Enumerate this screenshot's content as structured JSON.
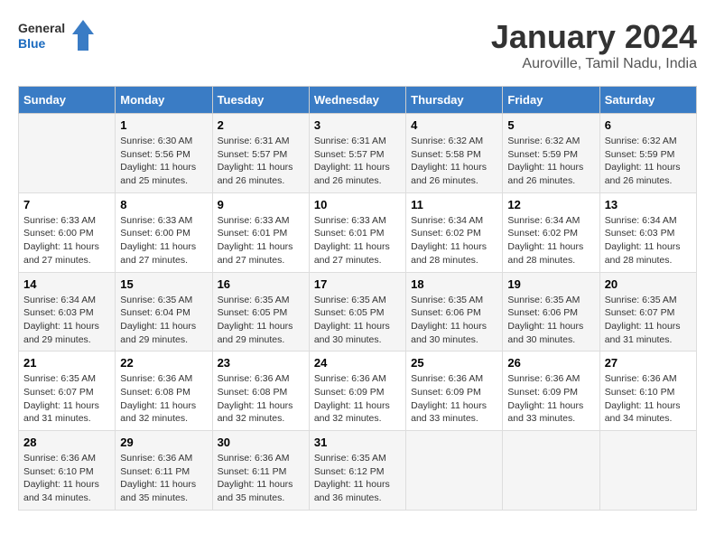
{
  "header": {
    "logo_general": "General",
    "logo_blue": "Blue",
    "main_title": "January 2024",
    "subtitle": "Auroville, Tamil Nadu, India"
  },
  "columns": [
    "Sunday",
    "Monday",
    "Tuesday",
    "Wednesday",
    "Thursday",
    "Friday",
    "Saturday"
  ],
  "weeks": [
    [
      {
        "day": "",
        "info": ""
      },
      {
        "day": "1",
        "info": "Sunrise: 6:30 AM\nSunset: 5:56 PM\nDaylight: 11 hours\nand 25 minutes."
      },
      {
        "day": "2",
        "info": "Sunrise: 6:31 AM\nSunset: 5:57 PM\nDaylight: 11 hours\nand 26 minutes."
      },
      {
        "day": "3",
        "info": "Sunrise: 6:31 AM\nSunset: 5:57 PM\nDaylight: 11 hours\nand 26 minutes."
      },
      {
        "day": "4",
        "info": "Sunrise: 6:32 AM\nSunset: 5:58 PM\nDaylight: 11 hours\nand 26 minutes."
      },
      {
        "day": "5",
        "info": "Sunrise: 6:32 AM\nSunset: 5:59 PM\nDaylight: 11 hours\nand 26 minutes."
      },
      {
        "day": "6",
        "info": "Sunrise: 6:32 AM\nSunset: 5:59 PM\nDaylight: 11 hours\nand 26 minutes."
      }
    ],
    [
      {
        "day": "7",
        "info": "Sunrise: 6:33 AM\nSunset: 6:00 PM\nDaylight: 11 hours\nand 27 minutes."
      },
      {
        "day": "8",
        "info": "Sunrise: 6:33 AM\nSunset: 6:00 PM\nDaylight: 11 hours\nand 27 minutes."
      },
      {
        "day": "9",
        "info": "Sunrise: 6:33 AM\nSunset: 6:01 PM\nDaylight: 11 hours\nand 27 minutes."
      },
      {
        "day": "10",
        "info": "Sunrise: 6:33 AM\nSunset: 6:01 PM\nDaylight: 11 hours\nand 27 minutes."
      },
      {
        "day": "11",
        "info": "Sunrise: 6:34 AM\nSunset: 6:02 PM\nDaylight: 11 hours\nand 28 minutes."
      },
      {
        "day": "12",
        "info": "Sunrise: 6:34 AM\nSunset: 6:02 PM\nDaylight: 11 hours\nand 28 minutes."
      },
      {
        "day": "13",
        "info": "Sunrise: 6:34 AM\nSunset: 6:03 PM\nDaylight: 11 hours\nand 28 minutes."
      }
    ],
    [
      {
        "day": "14",
        "info": "Sunrise: 6:34 AM\nSunset: 6:03 PM\nDaylight: 11 hours\nand 29 minutes."
      },
      {
        "day": "15",
        "info": "Sunrise: 6:35 AM\nSunset: 6:04 PM\nDaylight: 11 hours\nand 29 minutes."
      },
      {
        "day": "16",
        "info": "Sunrise: 6:35 AM\nSunset: 6:05 PM\nDaylight: 11 hours\nand 29 minutes."
      },
      {
        "day": "17",
        "info": "Sunrise: 6:35 AM\nSunset: 6:05 PM\nDaylight: 11 hours\nand 30 minutes."
      },
      {
        "day": "18",
        "info": "Sunrise: 6:35 AM\nSunset: 6:06 PM\nDaylight: 11 hours\nand 30 minutes."
      },
      {
        "day": "19",
        "info": "Sunrise: 6:35 AM\nSunset: 6:06 PM\nDaylight: 11 hours\nand 30 minutes."
      },
      {
        "day": "20",
        "info": "Sunrise: 6:35 AM\nSunset: 6:07 PM\nDaylight: 11 hours\nand 31 minutes."
      }
    ],
    [
      {
        "day": "21",
        "info": "Sunrise: 6:35 AM\nSunset: 6:07 PM\nDaylight: 11 hours\nand 31 minutes."
      },
      {
        "day": "22",
        "info": "Sunrise: 6:36 AM\nSunset: 6:08 PM\nDaylight: 11 hours\nand 32 minutes."
      },
      {
        "day": "23",
        "info": "Sunrise: 6:36 AM\nSunset: 6:08 PM\nDaylight: 11 hours\nand 32 minutes."
      },
      {
        "day": "24",
        "info": "Sunrise: 6:36 AM\nSunset: 6:09 PM\nDaylight: 11 hours\nand 32 minutes."
      },
      {
        "day": "25",
        "info": "Sunrise: 6:36 AM\nSunset: 6:09 PM\nDaylight: 11 hours\nand 33 minutes."
      },
      {
        "day": "26",
        "info": "Sunrise: 6:36 AM\nSunset: 6:09 PM\nDaylight: 11 hours\nand 33 minutes."
      },
      {
        "day": "27",
        "info": "Sunrise: 6:36 AM\nSunset: 6:10 PM\nDaylight: 11 hours\nand 34 minutes."
      }
    ],
    [
      {
        "day": "28",
        "info": "Sunrise: 6:36 AM\nSunset: 6:10 PM\nDaylight: 11 hours\nand 34 minutes."
      },
      {
        "day": "29",
        "info": "Sunrise: 6:36 AM\nSunset: 6:11 PM\nDaylight: 11 hours\nand 35 minutes."
      },
      {
        "day": "30",
        "info": "Sunrise: 6:36 AM\nSunset: 6:11 PM\nDaylight: 11 hours\nand 35 minutes."
      },
      {
        "day": "31",
        "info": "Sunrise: 6:35 AM\nSunset: 6:12 PM\nDaylight: 11 hours\nand 36 minutes."
      },
      {
        "day": "",
        "info": ""
      },
      {
        "day": "",
        "info": ""
      },
      {
        "day": "",
        "info": ""
      }
    ]
  ]
}
